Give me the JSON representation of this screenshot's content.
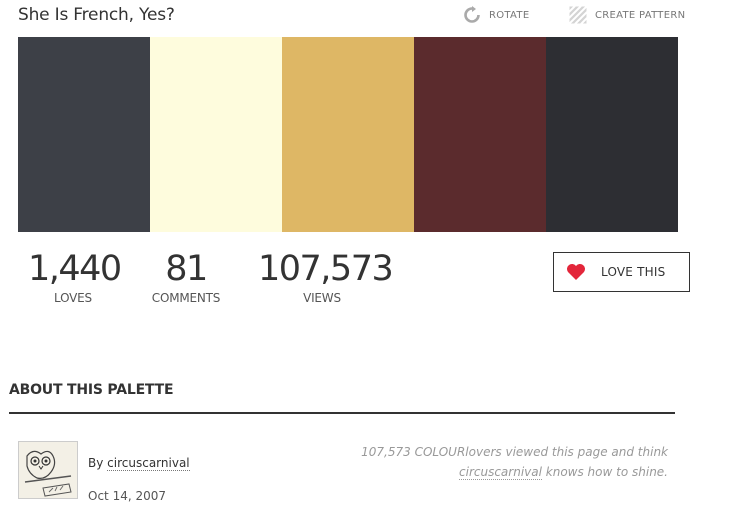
{
  "palette": {
    "title": "She Is French, Yes?",
    "colors": [
      "#3d4047",
      "#fefcdd",
      "#deb765",
      "#5b2b2d",
      "#2d2e33"
    ]
  },
  "toolbar": {
    "rotate_label": "ROTATE",
    "pattern_label": "CREATE PATTERN"
  },
  "stats": {
    "loves": {
      "value": "1,440",
      "label": "LOVES"
    },
    "comments": {
      "value": "81",
      "label": "COMMENTS"
    },
    "views": {
      "value": "107,573",
      "label": "VIEWS"
    }
  },
  "love_button": {
    "label": "LOVE THIS",
    "heart_color": "#e3263a"
  },
  "about": {
    "heading": "ABOUT THIS PALETTE",
    "by_prefix": "By",
    "author": "circuscarnival",
    "date": "Oct 14, 2007",
    "views_note_1": "107,573 COLOURlovers viewed this page and think",
    "views_note_user": "circuscarnival",
    "views_note_2": "knows how to shine."
  }
}
